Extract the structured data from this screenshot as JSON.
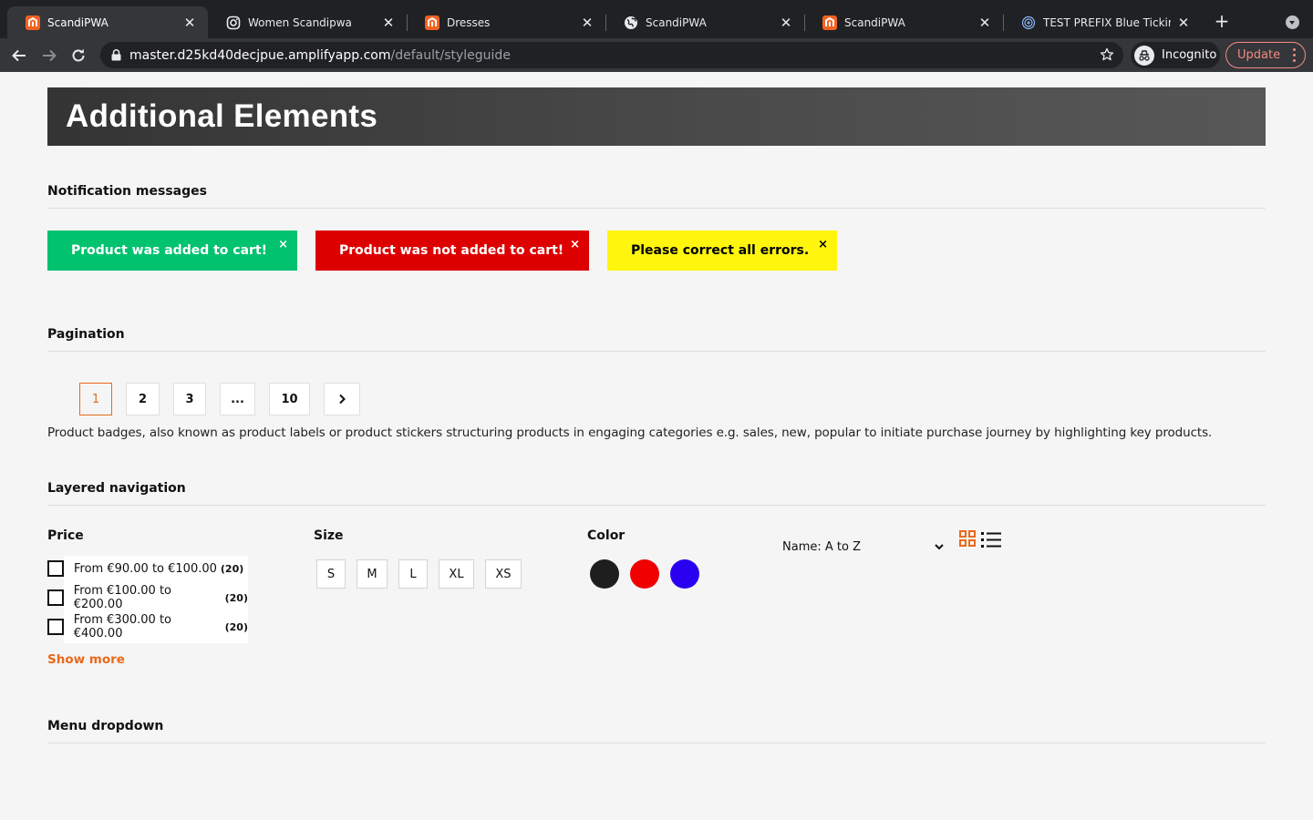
{
  "browser": {
    "tabs": [
      {
        "title": "ScandiPWA",
        "favicon": "magento-icon",
        "active": true
      },
      {
        "title": "Women Scandipwa",
        "favicon": "instagram-icon",
        "active": false
      },
      {
        "title": "Dresses",
        "favicon": "magento-icon",
        "active": false
      },
      {
        "title": "ScandiPWA",
        "favicon": "globe-icon",
        "active": false
      },
      {
        "title": "ScandiPWA",
        "favicon": "magento-icon",
        "active": false
      },
      {
        "title": "TEST PREFIX Blue Ticking I",
        "favicon": "fingerprint-icon",
        "active": false
      }
    ],
    "url_host": "master.d25kd40decjpue.amplifyapp.com",
    "url_path": "/default/styleguide",
    "profile_label": "Incognito",
    "update_label": "Update"
  },
  "page": {
    "title": "Additional Elements",
    "notifications_title": "Notification messages",
    "notifications": [
      {
        "text": "Product was added to cart!",
        "type": "success",
        "color": "#00c26f"
      },
      {
        "text": "Product was not added to cart!",
        "type": "error",
        "color": "#dd0000"
      },
      {
        "text": "Please correct all errors.",
        "type": "warning",
        "color": "#fff50d"
      }
    ],
    "close_glyph": "×",
    "pagination_title": "Pagination",
    "pagination": [
      "1",
      "2",
      "3",
      "...",
      "10"
    ],
    "pagination_current": "1",
    "badges_description": "Product badges, also known as product labels or product stickers structuring products in engaging categories e.g. sales, new, popular to initiate purchase journey by highlighting key products.",
    "layered_title": "Layered navigation",
    "price_label": "Price",
    "price_options": [
      {
        "label": "From €90.00 to €100.00",
        "count": "(20)"
      },
      {
        "label": "From €100.00 to €200.00",
        "count": "(20)"
      },
      {
        "label": "From €300.00 to €400.00",
        "count": "(20)"
      }
    ],
    "show_more": "Show more",
    "size_label": "Size",
    "sizes": [
      "S",
      "M",
      "L",
      "XL",
      "XS"
    ],
    "color_label": "Color",
    "colors": [
      "#1e1e1e",
      "#f00000",
      "#2a00f0"
    ],
    "sort_label": "Name: A to Z",
    "menu_dropdown_title": "Menu dropdown",
    "accent_color": "#e86a1c"
  }
}
